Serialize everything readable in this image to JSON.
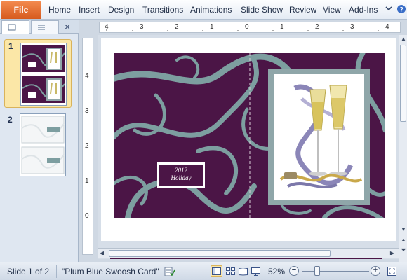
{
  "ribbon": {
    "file_label": "File",
    "tabs": [
      "Home",
      "Insert",
      "Design",
      "Transitions",
      "Animations",
      "Slide Show",
      "Review",
      "View",
      "Add-Ins"
    ]
  },
  "slides_pane": {
    "slides": [
      {
        "number": "1",
        "selected": true
      },
      {
        "number": "2",
        "selected": false
      }
    ]
  },
  "ruler": {
    "horizontal": [
      "4",
      "3",
      "2",
      "1",
      "0",
      "1",
      "2",
      "3",
      "4"
    ],
    "vertical": [
      "4",
      "3",
      "2",
      "1",
      "0"
    ]
  },
  "card": {
    "label_line1": "2012",
    "label_line2": "Holiday"
  },
  "status": {
    "slide_indicator": "Slide 1 of 2",
    "theme_name": "\"Plum Blue Swoosh Card\"",
    "zoom_level": "52%",
    "zoom_fraction": 0.52
  },
  "colors": {
    "plum": "#4b1546",
    "swoosh": "#7d9ea0",
    "file_tab": "#d65a1d"
  }
}
